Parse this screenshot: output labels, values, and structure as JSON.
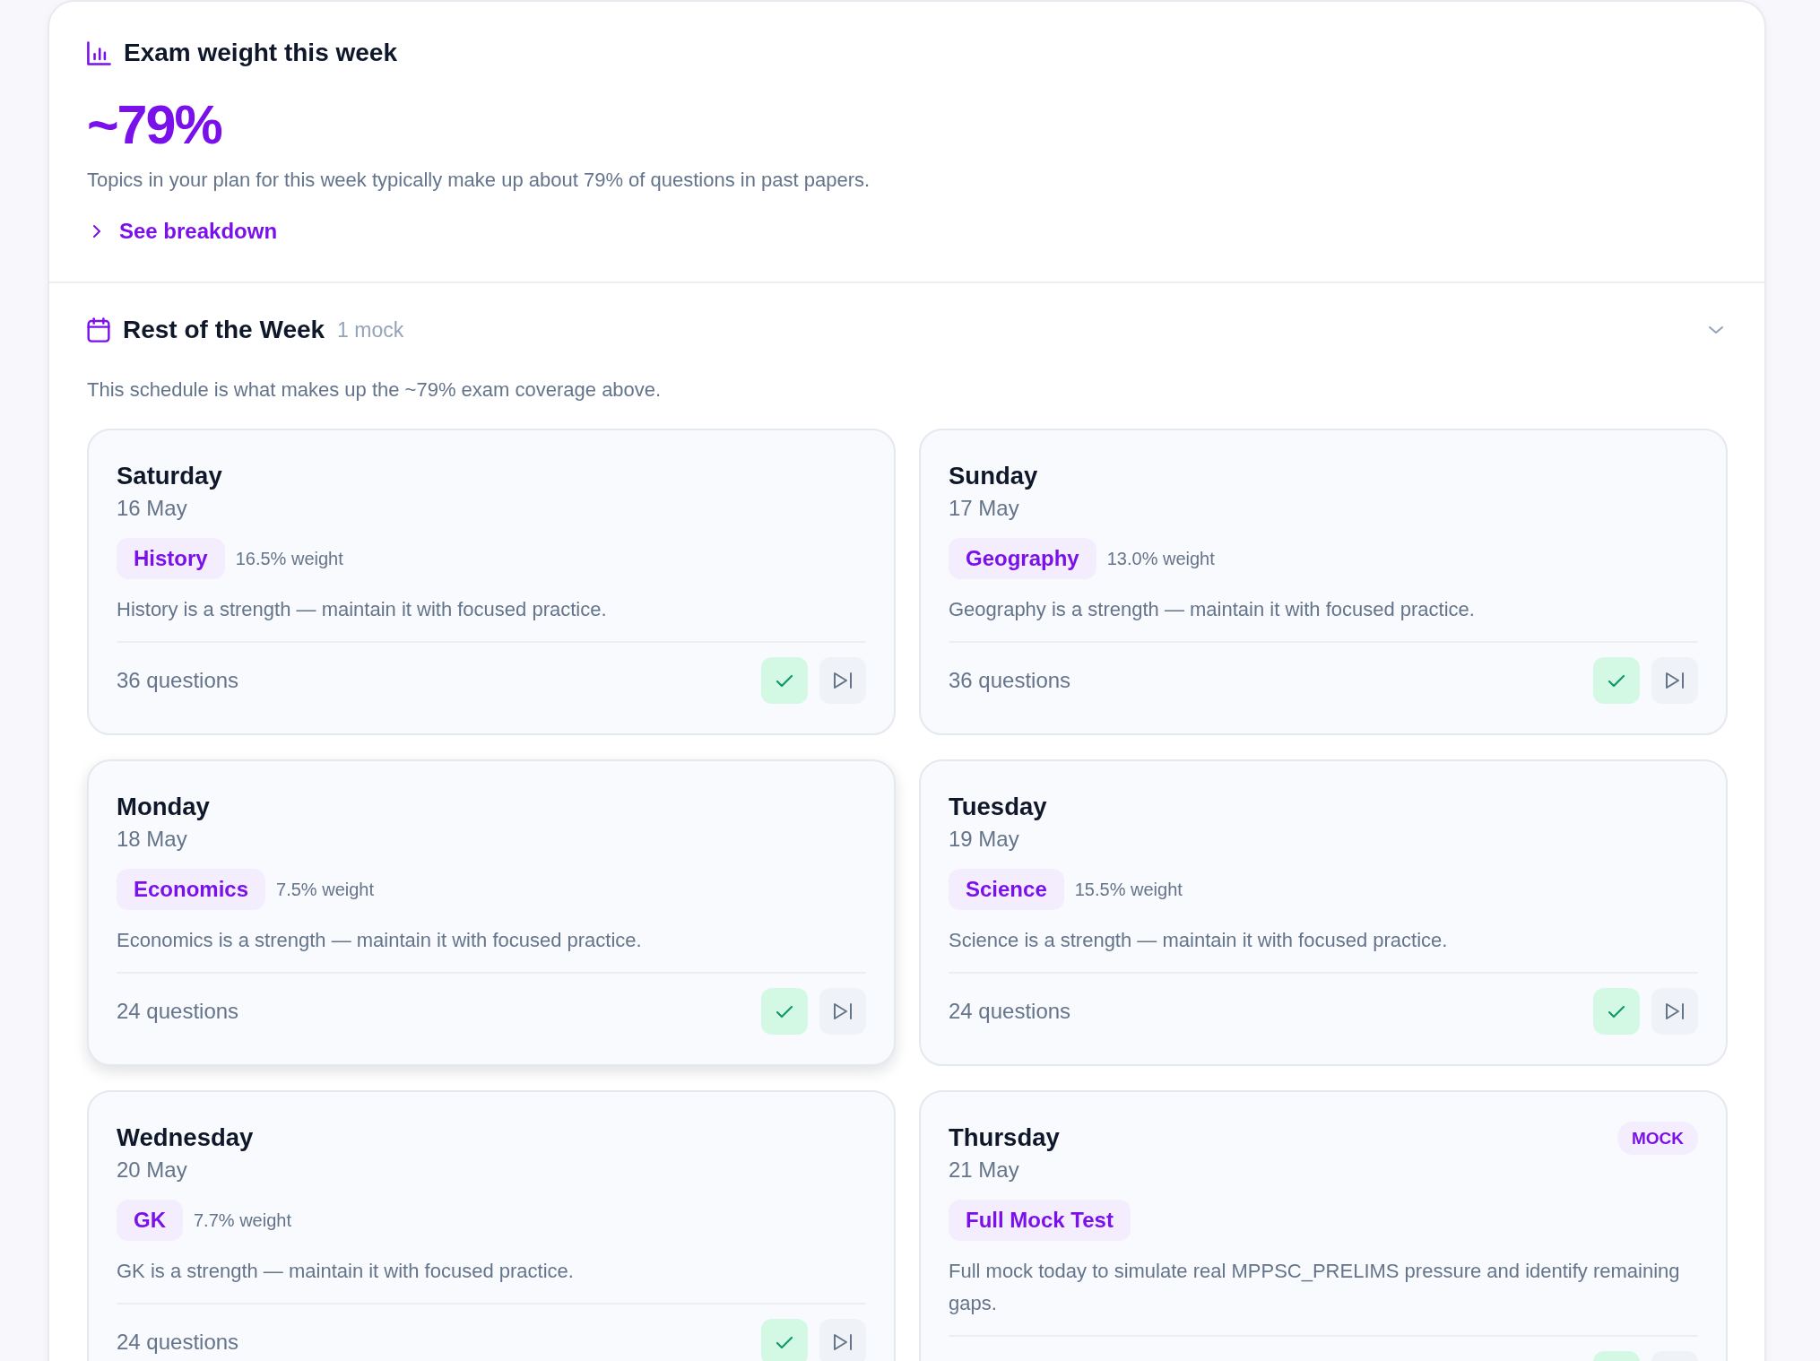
{
  "exam_weight": {
    "title": "Exam weight this week",
    "value": "~79%",
    "description": "Topics in your plan for this week typically make up about 79% of questions in past papers.",
    "link": "See breakdown",
    "expanded": false
  },
  "rest_of_week": {
    "title": "Rest of the Week",
    "count": "1 mock",
    "expanded": true,
    "description": "This schedule is what makes up the ~79% exam coverage above.",
    "days": [
      {
        "day": "Saturday",
        "date": "16 May",
        "topic": "History",
        "weight": "16.5% weight",
        "note": "History is a strength — maintain it with focused practice.",
        "questions": "36 questions",
        "selected": false
      },
      {
        "day": "Sunday",
        "date": "17 May",
        "topic": "Geography",
        "weight": "13.0% weight",
        "note": "Geography is a strength — maintain it with focused practice.",
        "questions": "36 questions",
        "selected": false
      },
      {
        "day": "Monday",
        "date": "18 May",
        "topic": "Economics",
        "weight": "7.5% weight",
        "note": "Economics is a strength — maintain it with focused practice.",
        "questions": "24 questions",
        "selected": true
      },
      {
        "day": "Tuesday",
        "date": "19 May",
        "topic": "Science",
        "weight": "15.5% weight",
        "note": "Science is a strength — maintain it with focused practice.",
        "questions": "24 questions",
        "selected": false
      },
      {
        "day": "Wednesday",
        "date": "20 May",
        "topic": "GK",
        "weight": "7.7% weight",
        "note": "GK is a strength — maintain it with focused practice.",
        "questions": "24 questions",
        "selected": false
      },
      {
        "day": "Thursday",
        "date": "21 May",
        "badge": "MOCK",
        "topic": "Full Mock Test",
        "note": "Full mock today to simulate real MPPSC_PRELIMS pressure and identify remaining gaps.",
        "selected": false
      }
    ]
  }
}
